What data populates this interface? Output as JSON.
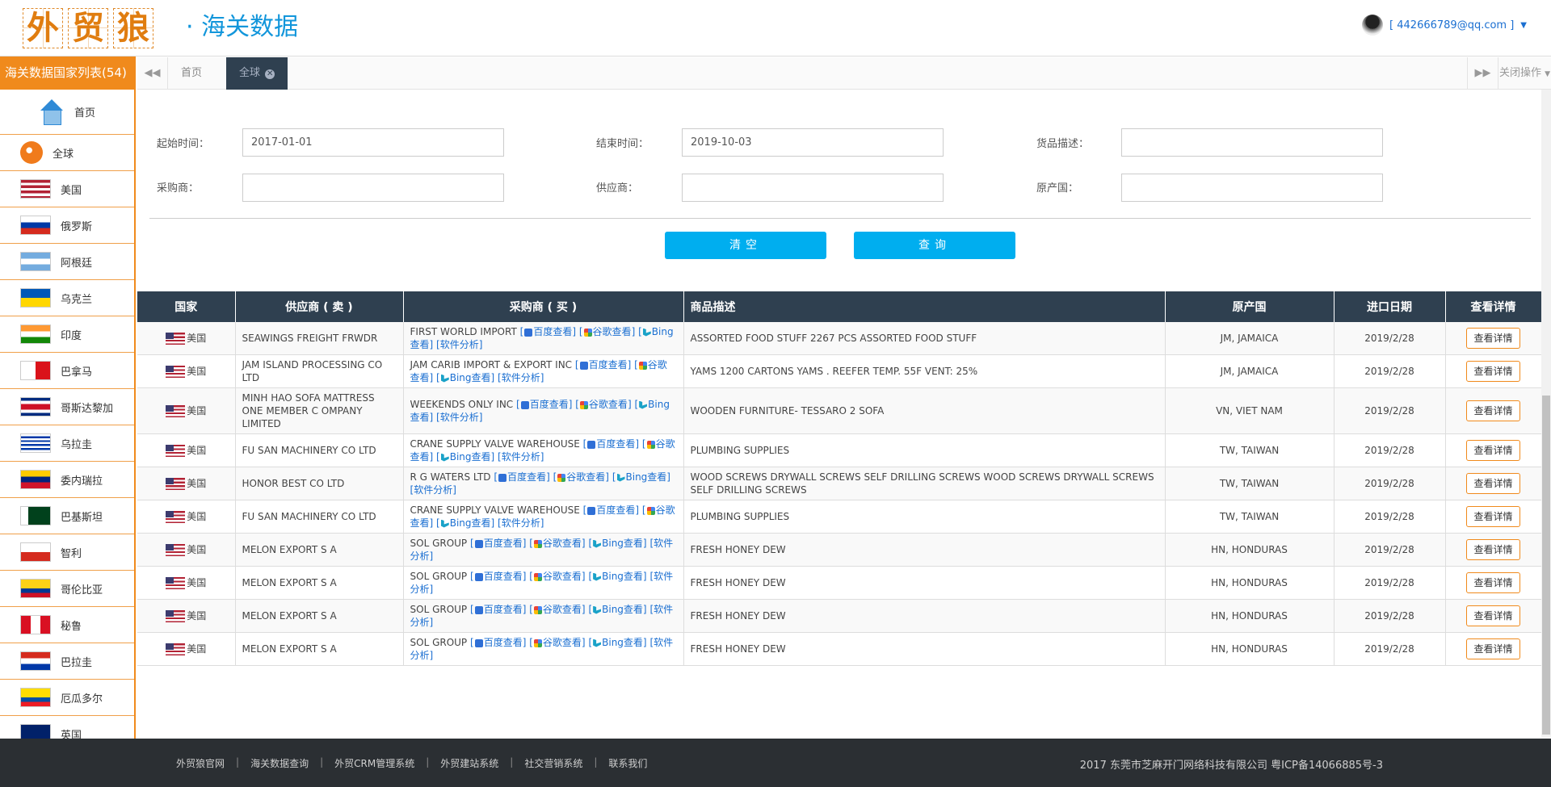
{
  "brand": {
    "logo_chars": [
      "外",
      "贸",
      "狼"
    ],
    "subtitle": "· 海关数据",
    "user_email": "[ 442666789@qq.com ]"
  },
  "sidebar": {
    "title": "海关数据国家列表(54)",
    "items": [
      {
        "label": "首页",
        "icon": "home-icon"
      },
      {
        "label": "全球",
        "icon": "globe-icon"
      },
      {
        "label": "美国",
        "flag": "us"
      },
      {
        "label": "俄罗斯",
        "flag": "ru"
      },
      {
        "label": "阿根廷",
        "flag": "ar"
      },
      {
        "label": "乌克兰",
        "flag": "ua"
      },
      {
        "label": "印度",
        "flag": "in"
      },
      {
        "label": "巴拿马",
        "flag": "pa"
      },
      {
        "label": "哥斯达黎加",
        "flag": "cr"
      },
      {
        "label": "乌拉圭",
        "flag": "uy"
      },
      {
        "label": "委内瑞拉",
        "flag": "ve"
      },
      {
        "label": "巴基斯坦",
        "flag": "pk"
      },
      {
        "label": "智利",
        "flag": "cl"
      },
      {
        "label": "哥伦比亚",
        "flag": "co"
      },
      {
        "label": "秘鲁",
        "flag": "pe"
      },
      {
        "label": "巴拉圭",
        "flag": "py"
      },
      {
        "label": "厄瓜多尔",
        "flag": "ec"
      },
      {
        "label": "英国",
        "flag": "gb"
      }
    ]
  },
  "tabs": {
    "home": "首页",
    "global": "全球",
    "close_ops": "关闭操作"
  },
  "form": {
    "start_label": "起始时间：",
    "start_value": "2017-01-01",
    "end_label": "结束时间：",
    "end_value": "2019-10-03",
    "goods_label": "货品描述：",
    "goods_value": "",
    "buyer_label": "采购商：",
    "buyer_value": "",
    "supplier_label": "供应商：",
    "supplier_value": "",
    "origin_label": "原产国：",
    "origin_value": "",
    "clear_button": "清空",
    "query_button": "查询"
  },
  "table": {
    "headers": [
      "国家",
      "供应商 ( 卖 )",
      "采购商 ( 买 )",
      "商品描述",
      "原产国",
      "进口日期",
      "查看详情"
    ],
    "link_labels": {
      "baidu": "百度查看",
      "google": "谷歌查看",
      "bing": "Bing查看",
      "analysis": "软件分析"
    },
    "detail_label": "查看详情",
    "rows": [
      {
        "country": "美国",
        "supplier": "SEAWINGS FREIGHT FRWDR",
        "buyer": "FIRST WORLD IMPORT",
        "desc": "ASSORTED FOOD STUFF 2267 PCS ASSORTED FOOD STUFF",
        "origin": "JM, JAMAICA",
        "date": "2019/2/28"
      },
      {
        "country": "美国",
        "supplier": "JAM ISLAND PROCESSING CO LTD",
        "buyer": "JAM CARIB IMPORT & EXPORT INC",
        "desc": "YAMS 1200 CARTONS YAMS . REEFER TEMP. 55F VENT: 25%",
        "origin": "JM, JAMAICA",
        "date": "2019/2/28"
      },
      {
        "country": "美国",
        "supplier": "MINH HAO SOFA MATTRESS ONE MEMBER C OMPANY LIMITED",
        "buyer": "WEEKENDS ONLY INC",
        "desc": "WOODEN FURNITURE- TESSARO 2 SOFA",
        "origin": "VN, VIET NAM",
        "date": "2019/2/28"
      },
      {
        "country": "美国",
        "supplier": "FU SAN MACHINERY CO LTD",
        "buyer": "CRANE SUPPLY VALVE WAREHOUSE",
        "desc": "PLUMBING SUPPLIES",
        "origin": "TW, TAIWAN",
        "date": "2019/2/28"
      },
      {
        "country": "美国",
        "supplier": "HONOR BEST CO LTD",
        "buyer": "R G WATERS LTD",
        "desc": "WOOD SCREWS DRYWALL SCREWS SELF DRILLING SCREWS WOOD SCREWS DRYWALL SCREWS SELF DRILLING SCREWS",
        "origin": "TW, TAIWAN",
        "date": "2019/2/28"
      },
      {
        "country": "美国",
        "supplier": "FU SAN MACHINERY CO LTD",
        "buyer": "CRANE SUPPLY VALVE WAREHOUSE",
        "desc": "PLUMBING SUPPLIES",
        "origin": "TW, TAIWAN",
        "date": "2019/2/28"
      },
      {
        "country": "美国",
        "supplier": "MELON EXPORT S A",
        "buyer": "SOL GROUP",
        "desc": "FRESH HONEY DEW",
        "origin": "HN, HONDURAS",
        "date": "2019/2/28"
      },
      {
        "country": "美国",
        "supplier": "MELON EXPORT S A",
        "buyer": "SOL GROUP",
        "desc": "FRESH HONEY DEW",
        "origin": "HN, HONDURAS",
        "date": "2019/2/28"
      },
      {
        "country": "美国",
        "supplier": "MELON EXPORT S A",
        "buyer": "SOL GROUP",
        "desc": "FRESH HONEY DEW",
        "origin": "HN, HONDURAS",
        "date": "2019/2/28"
      },
      {
        "country": "美国",
        "supplier": "MELON EXPORT S A",
        "buyer": "SOL GROUP",
        "desc": "FRESH HONEY DEW",
        "origin": "HN, HONDURAS",
        "date": "2019/2/28"
      }
    ]
  },
  "footer": {
    "links": [
      "外贸狼官网",
      "海关数据查询",
      "外贸CRM管理系统",
      "外贸建站系统",
      "社交营销系统",
      "联系我们"
    ],
    "copyright": "2017 东莞市芝麻开门网络科技有限公司 粤ICP备14066885号-3"
  },
  "colors": {
    "accent": "#f08a1c",
    "header": "#2f4050",
    "button": "#00aeef",
    "link": "#1b6fd1"
  }
}
